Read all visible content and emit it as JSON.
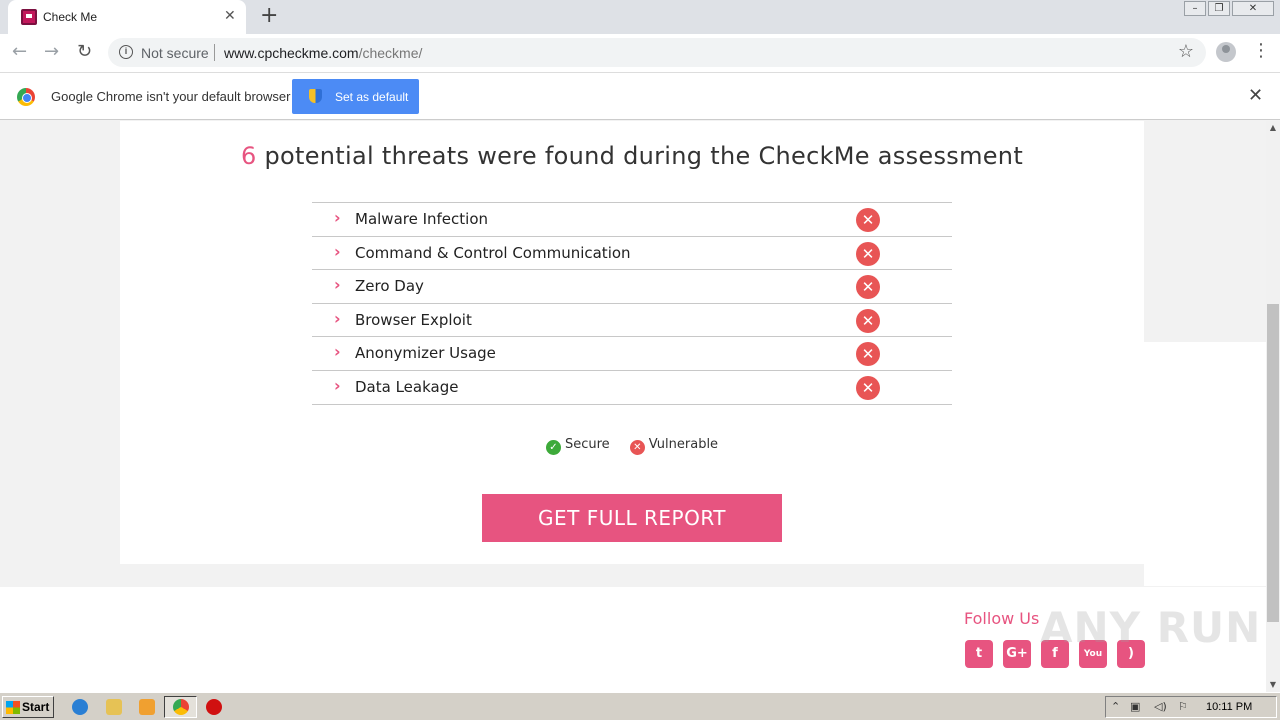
{
  "browser": {
    "tab_title": "Check Me",
    "tab_close": "✕",
    "new_tab": "+",
    "address": {
      "security_label": "Not secure",
      "url_host": "www.cpcheckme.com",
      "url_path": "/checkme/"
    },
    "infobar": {
      "message": "Google Chrome isn't your default browser",
      "button_label": "Set as default",
      "close": "✕"
    }
  },
  "page": {
    "headline_count": "6",
    "headline_text": "potential threats were found during the CheckMe assessment",
    "threats": [
      {
        "label": "Malware Infection",
        "status": "vulnerable"
      },
      {
        "label": "Command & Control Communication",
        "status": "vulnerable"
      },
      {
        "label": "Zero Day",
        "status": "vulnerable"
      },
      {
        "label": "Browser Exploit",
        "status": "vulnerable"
      },
      {
        "label": "Anonymizer Usage",
        "status": "vulnerable"
      },
      {
        "label": "Data Leakage",
        "status": "vulnerable"
      }
    ],
    "legend": {
      "secure_label": "Secure",
      "vulnerable_label": "Vulnerable"
    },
    "cta_label": "GET FULL REPORT",
    "footer": {
      "follow_us": "Follow Us",
      "social_icons": [
        "twitter-icon",
        "google-plus-icon",
        "facebook-icon",
        "youtube-icon",
        "rss-icon"
      ]
    },
    "watermark": "ANY RUN"
  },
  "colors": {
    "accent": "#e75480",
    "vulnerable": "#e85555",
    "secure": "#3daa3a",
    "chrome_blue": "#4c8bf5"
  },
  "taskbar": {
    "start_label": "Start",
    "clock": "10:11 PM"
  }
}
